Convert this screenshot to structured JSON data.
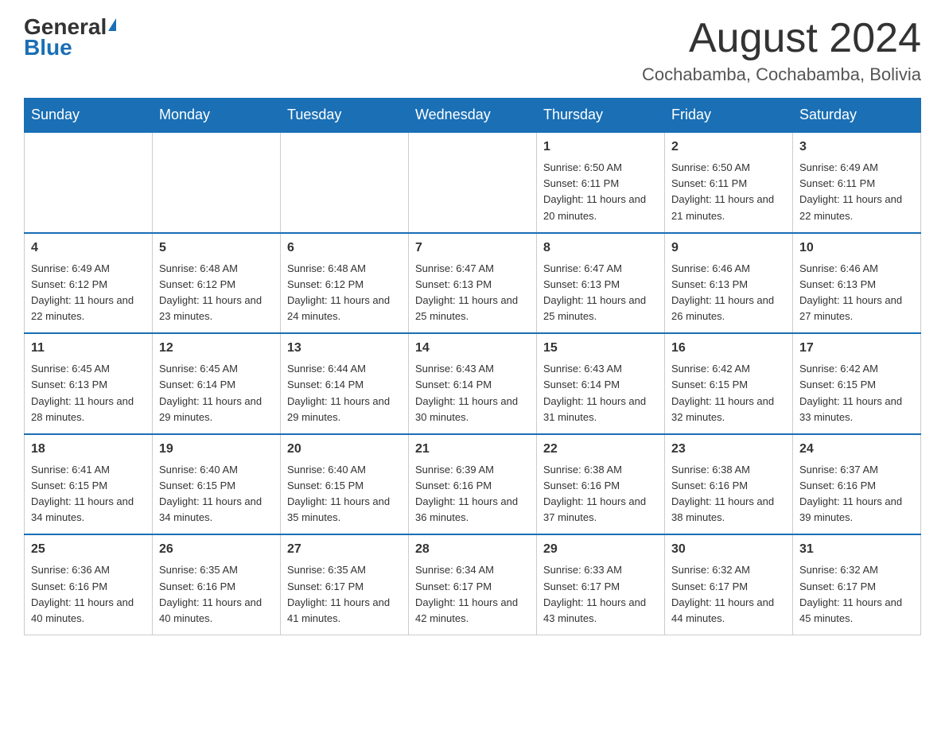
{
  "logo": {
    "general": "General",
    "blue": "Blue"
  },
  "header": {
    "month_year": "August 2024",
    "location": "Cochabamba, Cochabamba, Bolivia"
  },
  "days_of_week": [
    "Sunday",
    "Monday",
    "Tuesday",
    "Wednesday",
    "Thursday",
    "Friday",
    "Saturday"
  ],
  "weeks": [
    [
      {
        "day": "",
        "info": ""
      },
      {
        "day": "",
        "info": ""
      },
      {
        "day": "",
        "info": ""
      },
      {
        "day": "",
        "info": ""
      },
      {
        "day": "1",
        "info": "Sunrise: 6:50 AM\nSunset: 6:11 PM\nDaylight: 11 hours and 20 minutes."
      },
      {
        "day": "2",
        "info": "Sunrise: 6:50 AM\nSunset: 6:11 PM\nDaylight: 11 hours and 21 minutes."
      },
      {
        "day": "3",
        "info": "Sunrise: 6:49 AM\nSunset: 6:11 PM\nDaylight: 11 hours and 22 minutes."
      }
    ],
    [
      {
        "day": "4",
        "info": "Sunrise: 6:49 AM\nSunset: 6:12 PM\nDaylight: 11 hours and 22 minutes."
      },
      {
        "day": "5",
        "info": "Sunrise: 6:48 AM\nSunset: 6:12 PM\nDaylight: 11 hours and 23 minutes."
      },
      {
        "day": "6",
        "info": "Sunrise: 6:48 AM\nSunset: 6:12 PM\nDaylight: 11 hours and 24 minutes."
      },
      {
        "day": "7",
        "info": "Sunrise: 6:47 AM\nSunset: 6:13 PM\nDaylight: 11 hours and 25 minutes."
      },
      {
        "day": "8",
        "info": "Sunrise: 6:47 AM\nSunset: 6:13 PM\nDaylight: 11 hours and 25 minutes."
      },
      {
        "day": "9",
        "info": "Sunrise: 6:46 AM\nSunset: 6:13 PM\nDaylight: 11 hours and 26 minutes."
      },
      {
        "day": "10",
        "info": "Sunrise: 6:46 AM\nSunset: 6:13 PM\nDaylight: 11 hours and 27 minutes."
      }
    ],
    [
      {
        "day": "11",
        "info": "Sunrise: 6:45 AM\nSunset: 6:13 PM\nDaylight: 11 hours and 28 minutes."
      },
      {
        "day": "12",
        "info": "Sunrise: 6:45 AM\nSunset: 6:14 PM\nDaylight: 11 hours and 29 minutes."
      },
      {
        "day": "13",
        "info": "Sunrise: 6:44 AM\nSunset: 6:14 PM\nDaylight: 11 hours and 29 minutes."
      },
      {
        "day": "14",
        "info": "Sunrise: 6:43 AM\nSunset: 6:14 PM\nDaylight: 11 hours and 30 minutes."
      },
      {
        "day": "15",
        "info": "Sunrise: 6:43 AM\nSunset: 6:14 PM\nDaylight: 11 hours and 31 minutes."
      },
      {
        "day": "16",
        "info": "Sunrise: 6:42 AM\nSunset: 6:15 PM\nDaylight: 11 hours and 32 minutes."
      },
      {
        "day": "17",
        "info": "Sunrise: 6:42 AM\nSunset: 6:15 PM\nDaylight: 11 hours and 33 minutes."
      }
    ],
    [
      {
        "day": "18",
        "info": "Sunrise: 6:41 AM\nSunset: 6:15 PM\nDaylight: 11 hours and 34 minutes."
      },
      {
        "day": "19",
        "info": "Sunrise: 6:40 AM\nSunset: 6:15 PM\nDaylight: 11 hours and 34 minutes."
      },
      {
        "day": "20",
        "info": "Sunrise: 6:40 AM\nSunset: 6:15 PM\nDaylight: 11 hours and 35 minutes."
      },
      {
        "day": "21",
        "info": "Sunrise: 6:39 AM\nSunset: 6:16 PM\nDaylight: 11 hours and 36 minutes."
      },
      {
        "day": "22",
        "info": "Sunrise: 6:38 AM\nSunset: 6:16 PM\nDaylight: 11 hours and 37 minutes."
      },
      {
        "day": "23",
        "info": "Sunrise: 6:38 AM\nSunset: 6:16 PM\nDaylight: 11 hours and 38 minutes."
      },
      {
        "day": "24",
        "info": "Sunrise: 6:37 AM\nSunset: 6:16 PM\nDaylight: 11 hours and 39 minutes."
      }
    ],
    [
      {
        "day": "25",
        "info": "Sunrise: 6:36 AM\nSunset: 6:16 PM\nDaylight: 11 hours and 40 minutes."
      },
      {
        "day": "26",
        "info": "Sunrise: 6:35 AM\nSunset: 6:16 PM\nDaylight: 11 hours and 40 minutes."
      },
      {
        "day": "27",
        "info": "Sunrise: 6:35 AM\nSunset: 6:17 PM\nDaylight: 11 hours and 41 minutes."
      },
      {
        "day": "28",
        "info": "Sunrise: 6:34 AM\nSunset: 6:17 PM\nDaylight: 11 hours and 42 minutes."
      },
      {
        "day": "29",
        "info": "Sunrise: 6:33 AM\nSunset: 6:17 PM\nDaylight: 11 hours and 43 minutes."
      },
      {
        "day": "30",
        "info": "Sunrise: 6:32 AM\nSunset: 6:17 PM\nDaylight: 11 hours and 44 minutes."
      },
      {
        "day": "31",
        "info": "Sunrise: 6:32 AM\nSunset: 6:17 PM\nDaylight: 11 hours and 45 minutes."
      }
    ]
  ]
}
